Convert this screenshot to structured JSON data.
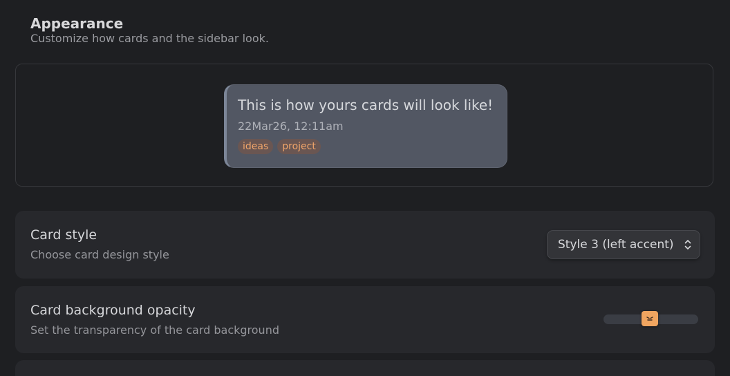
{
  "appearance": {
    "title": "Appearance",
    "subtitle": "Customize how cards and the sidebar look."
  },
  "preview": {
    "text": "This is how yours cards will look like!",
    "date": "22Mar26, 12:11am",
    "tags": [
      "ideas",
      "project"
    ],
    "colors": {
      "card_bg": "#525763",
      "accent": "#7c8698",
      "tag_text": "#f0a56a",
      "tag_bg": "#6a5652"
    }
  },
  "settings": {
    "card_style": {
      "title": "Card style",
      "description": "Choose card design style",
      "selected": "Style 3 (left accent)",
      "icon": "chevron-up-down-icon"
    },
    "card_opacity": {
      "title": "Card background opacity",
      "description": "Set the transparency of the card background",
      "value_fraction": 0.49,
      "thumb_color": "#f0a560",
      "thumb_icon": "grip-lines-icon"
    }
  }
}
